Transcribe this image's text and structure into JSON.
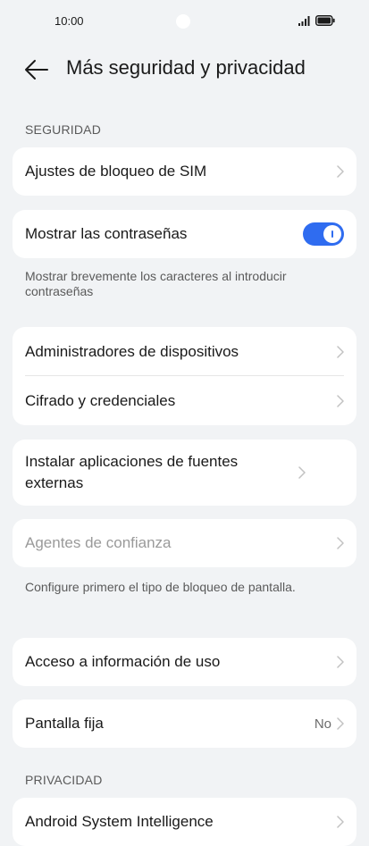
{
  "status_bar": {
    "time": "10:00",
    "icons": [
      "signal-icon",
      "battery-icon"
    ]
  },
  "header": {
    "title": "Más seguridad y privacidad",
    "back_icon": "arrow-left-icon"
  },
  "sections": {
    "security_header": "SEGURIDAD",
    "privacy_header": "PRIVACIDAD"
  },
  "items": {
    "sim_lock": "Ajustes de bloqueo de SIM",
    "show_passwords": "Mostrar las contraseñas",
    "show_passwords_note": "Mostrar brevemente los caracteres al introducir contraseñas",
    "device_admins": "Administradores de dispositivos",
    "encryption": "Cifrado y credenciales",
    "external_sources": "Instalar aplicaciones de fuentes externas",
    "trust_agents": "Agentes de confianza",
    "trust_agents_note": "Configure primero el tipo de bloqueo de pantalla.",
    "usage_access": "Acceso a información de uso",
    "screen_pinning": "Pantalla fija",
    "screen_pinning_value": "No",
    "android_intelligence": "Android System Intelligence"
  },
  "toggles": {
    "show_passwords_on": true
  },
  "colors": {
    "accent": "#2f6cf0",
    "background": "#f1f3f5",
    "card": "#ffffff",
    "disabled_text": "#9a9a9a"
  }
}
